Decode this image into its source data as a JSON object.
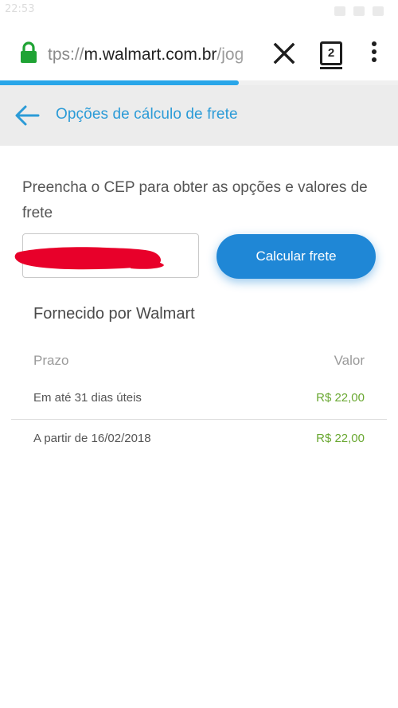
{
  "status_bar": {
    "time": "22:53"
  },
  "browser": {
    "url_scheme": "tps://",
    "url_host": "m.walmart.com.br",
    "url_path": "/jog",
    "tab_count": "2",
    "icons": {
      "lock": "lock-icon",
      "close": "close-icon",
      "tabs": "tabs-icon",
      "menu": "more-vert-icon"
    },
    "progress_fraction": 0.6,
    "progress_color": "#29a6e9"
  },
  "header": {
    "title": "Opções de cálculo de frete",
    "back_icon": "arrow-left-icon",
    "accent_color": "#2b9bd7"
  },
  "form": {
    "instructions": "Preencha o CEP para obter as opções e valores de frete",
    "cep_value": "",
    "calc_button_label": "Calcular frete",
    "button_color": "#1f87d6"
  },
  "shipping": {
    "provider": "Fornecido por Walmart",
    "column_prazo": "Prazo",
    "column_valor": "Valor",
    "rows": [
      {
        "prazo": "Em até 31 dias úteis",
        "valor": "R$ 22,00"
      },
      {
        "prazo": "A partir de 16/02/2018",
        "valor": "R$ 22,00"
      }
    ],
    "price_color": "#6aa832"
  }
}
